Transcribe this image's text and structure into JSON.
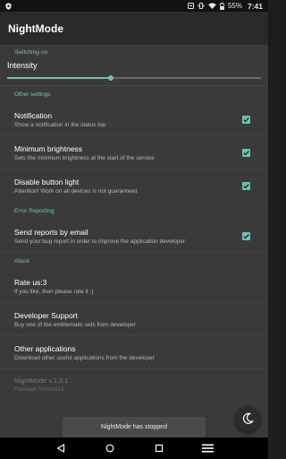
{
  "status_bar": {
    "battery": "55%",
    "time": "7:41",
    "icons": [
      "shield-icon",
      "notification-icon",
      "vibrate-icon",
      "wifi-icon",
      "battery-icon"
    ]
  },
  "app_bar": {
    "title": "NightMode"
  },
  "switching": {
    "header": "Switching-on",
    "intensity_label": "Intensity",
    "intensity_value": 0.41
  },
  "other_settings": {
    "header": "Other settings",
    "items": [
      {
        "title": "Notification",
        "summary": "Show a notification in the status bar",
        "checked": true
      },
      {
        "title": "Minimum brightness",
        "summary": "Sets the minimum brightness at the start of the service",
        "checked": true
      },
      {
        "title": "Disable button light",
        "summary": "Attention! Work on all devices is not guaranteed",
        "checked": true
      }
    ]
  },
  "error_reporting": {
    "header": "Error Reporting",
    "items": [
      {
        "title": "Send reports by email",
        "summary": "Send your bug report in order to improve the application developer",
        "checked": true
      }
    ]
  },
  "about": {
    "header": "About",
    "items": [
      {
        "title": "Rate us:3",
        "summary": "If you like, then please rate it :)"
      },
      {
        "title": "Developer Support",
        "summary": "Buy one of the emblematic sets from developer"
      },
      {
        "title": "Other applications",
        "summary": "Download other useful applications from the developer"
      }
    ],
    "version": "NightMode v.1.3.1",
    "package": "Package NVM1615"
  },
  "toast": {
    "text": "NightMode has stopped"
  },
  "fab": {
    "icon": "moon-icon"
  },
  "colors": {
    "accent": "#6fc0b3",
    "background": "#3a3a3a",
    "app_bar": "#2a2a2a"
  }
}
